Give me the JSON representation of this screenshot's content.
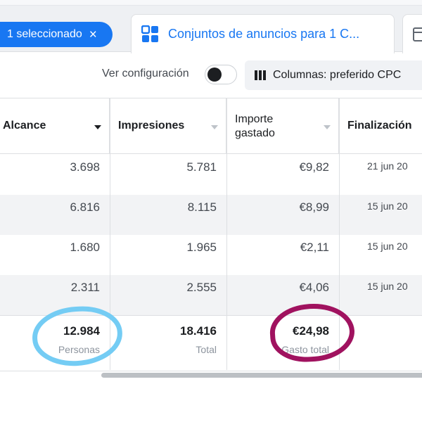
{
  "tabs": {
    "selection_label": "1 seleccionado",
    "selection_clear": "×",
    "active_label": "Conjuntos de anuncios para 1 C...",
    "active_icon": "grid-icon"
  },
  "toolbar": {
    "view_settings_label": "Ver configuración",
    "view_settings_on": false,
    "columns_label": "Columnas: preferido CPC"
  },
  "table": {
    "headers": {
      "reach": "Alcance",
      "impressions": "Impresiones",
      "spent_line1": "Importe",
      "spent_line2": "gastado",
      "end": "Finalización"
    },
    "rows": [
      {
        "reach": "3.698",
        "impressions": "5.781",
        "spent": "€9,82",
        "end": "21 jun 20"
      },
      {
        "reach": "6.816",
        "impressions": "8.115",
        "spent": "€8,99",
        "end": "15 jun 20"
      },
      {
        "reach": "1.680",
        "impressions": "1.965",
        "spent": "€2,11",
        "end": "15 jun 20"
      },
      {
        "reach": "2.311",
        "impressions": "2.555",
        "spent": "€4,06",
        "end": "15 jun 20"
      }
    ],
    "totals": {
      "reach": "12.984",
      "reach_sub": "Personas",
      "impressions": "18.416",
      "impressions_sub": "Total",
      "spent": "€24,98",
      "spent_sub": "Gasto total"
    }
  },
  "colors": {
    "accent": "#1877f2",
    "annotation_blue": "#74ccf4",
    "annotation_purple": "#a0125f"
  }
}
